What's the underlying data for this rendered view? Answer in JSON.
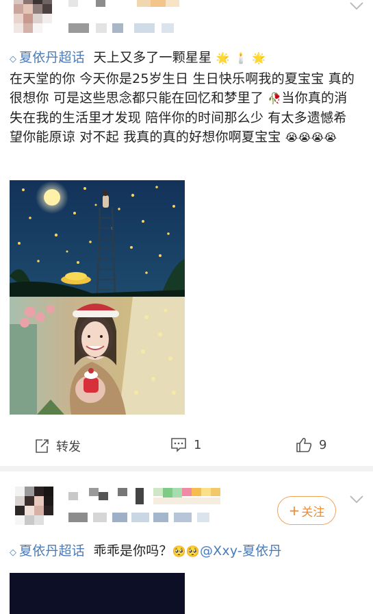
{
  "post1": {
    "topic": "夏依丹超话",
    "text_line1": "天上又多了一颗星星",
    "text_body": "在天堂的你 今天你是25岁生日 生日快乐啊我的夏宝宝 真的很想你 可是这些思念都只能在回忆和梦里了",
    "text_body2": "当你真的消失在我的生活里才发现 陪伴你的时间那么少 有太多遗憾希望你能原谅 对不起 我真的真的好想你啊夏宝宝",
    "emoji_stars": "🌟",
    "emoji_candle": "🕯️",
    "emoji_rose": "🥀",
    "emoji_cry": "😭😭😭😭",
    "actions": {
      "repost_label": "转发",
      "comment_count": "1",
      "like_count": "9"
    }
  },
  "post2": {
    "topic": "夏依丹超话",
    "text": "乖乖是你吗？",
    "emoji": "🥺🥺",
    "mention": "@Xxy-夏依丹",
    "follow_label": "关注",
    "follow_plus": "+"
  },
  "icons": {
    "topic": "diamond-icon",
    "repost": "share-icon",
    "comment": "comment-icon",
    "like": "thumbs-up-icon",
    "more": "chevron-down-icon"
  },
  "colors": {
    "topic_link": "#4a7bb8",
    "follow_orange": "#ef8a2f",
    "text": "#222222"
  }
}
